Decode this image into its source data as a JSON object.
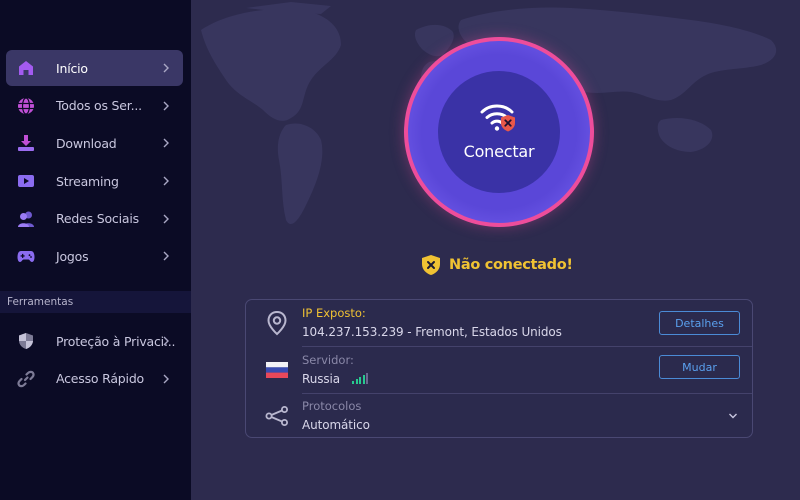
{
  "sidebar": {
    "items": [
      {
        "label": "Início",
        "icon": "home-icon",
        "active": true
      },
      {
        "label": "Todos os Ser...",
        "icon": "globe-icon"
      },
      {
        "label": "Download",
        "icon": "download-icon"
      },
      {
        "label": "Streaming",
        "icon": "play-icon"
      },
      {
        "label": "Redes Sociais",
        "icon": "users-icon"
      },
      {
        "label": "Jogos",
        "icon": "gamepad-icon"
      }
    ],
    "tools_header": "Ferramentas",
    "tools": [
      {
        "label": "Proteção à Privaci...",
        "icon": "shield-icon"
      },
      {
        "label": "Acesso Rápido",
        "icon": "link-icon"
      }
    ]
  },
  "connect": {
    "label": "Conectar",
    "icon": "wifi-shield-x-icon"
  },
  "status": {
    "text": "Não conectado!",
    "color": "#f0c233"
  },
  "info": {
    "ip": {
      "label": "IP Exposto:",
      "value": "104.237.153.239 - Fremont, Estados Unidos",
      "button": "Detalhes"
    },
    "server": {
      "label": "Servidor:",
      "value": "Russia",
      "signal_bars": 5,
      "button": "Mudar"
    },
    "protocol": {
      "label": "Protocolos",
      "value": "Automático"
    }
  },
  "colors": {
    "accent_purple": "#8b5cf6",
    "ring_pink": "#ee4d9b",
    "button_blue": "#5aa0ee",
    "signal_green": "#27c98f"
  }
}
